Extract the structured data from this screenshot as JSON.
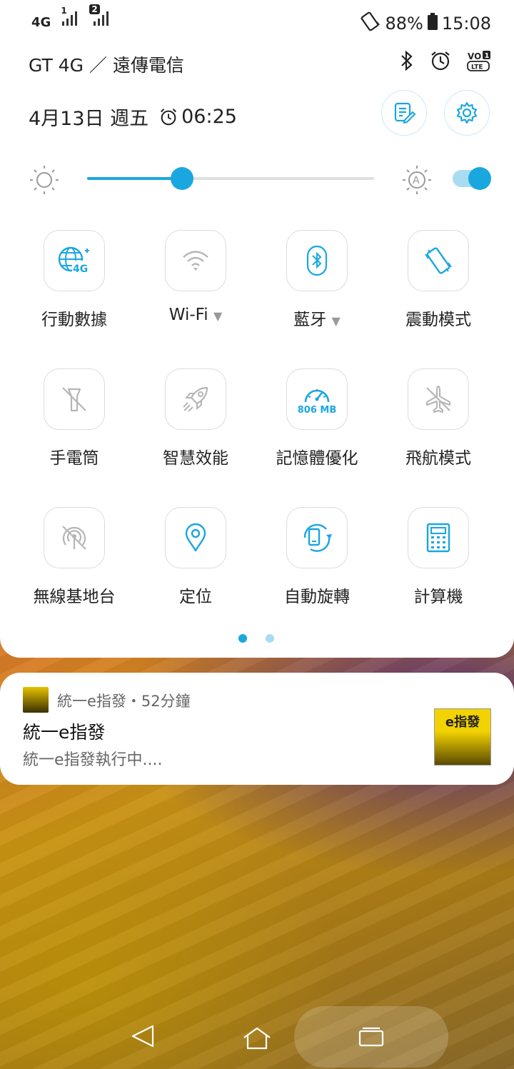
{
  "status_bar": {
    "network_type": "4G",
    "sim1_label": "1",
    "sim2_label": "2",
    "battery": "88%",
    "time": "15:08"
  },
  "header": {
    "carrier": "GT 4G ／ 遠傳電信",
    "date": "4月13日 週五",
    "alarm": "06:25",
    "status_icons": [
      "bluetooth-icon",
      "alarm-clock-icon",
      "volte-icon"
    ]
  },
  "brightness": {
    "level": 0.33,
    "auto_enabled": true
  },
  "tiles": [
    {
      "label": "行動數據",
      "icon": "mobile-data-icon",
      "active": true,
      "badge": "4G"
    },
    {
      "label": "Wi-Fi",
      "icon": "wifi-icon",
      "active": false,
      "has_dropdown": true
    },
    {
      "label": "藍牙",
      "icon": "bluetooth-icon",
      "active": true,
      "has_dropdown": true
    },
    {
      "label": "震動模式",
      "icon": "vibrate-icon",
      "active": true
    },
    {
      "label": "手電筒",
      "icon": "flashlight-off-icon",
      "active": false
    },
    {
      "label": "智慧效能",
      "icon": "rocket-icon",
      "active": false
    },
    {
      "label": "記憶體優化",
      "icon": "memory-gauge-icon",
      "active": true,
      "badge": "806 MB"
    },
    {
      "label": "飛航模式",
      "icon": "airplane-off-icon",
      "active": false
    },
    {
      "label": "無線基地台",
      "icon": "hotspot-off-icon",
      "active": false
    },
    {
      "label": "定位",
      "icon": "location-icon",
      "active": true
    },
    {
      "label": "自動旋轉",
      "icon": "auto-rotate-icon",
      "active": true
    },
    {
      "label": "計算機",
      "icon": "calculator-icon",
      "active": true
    }
  ],
  "pager": {
    "pages": 2,
    "current": 1
  },
  "notification": {
    "app_line": "統一e指發・52分鐘",
    "title": "統一e指發",
    "text": "統一e指發執行中....",
    "thumb_text": "e指發"
  },
  "colors": {
    "accent": "#1aa7e0",
    "inactive": "#b5b5b5"
  }
}
